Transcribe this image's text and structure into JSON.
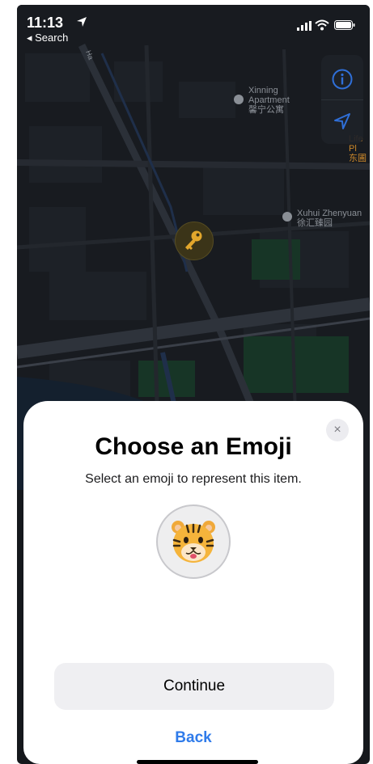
{
  "status_bar": {
    "time": "11:13",
    "back_app": "◂ Search",
    "icons": [
      "location-arrow-icon",
      "cellular-signal-icon",
      "wifi-icon",
      "battery-icon"
    ]
  },
  "map": {
    "pois": [
      {
        "name_en": "Xinning",
        "name_en_2": "Apartment",
        "name_zh": "馨宁公寓"
      },
      {
        "name_en": "Xuhui Zhenyuan",
        "name_zh": "徐汇臻园"
      },
      {
        "name_en": "Life Pl",
        "name_zh": "东圃"
      }
    ],
    "street_label": "Ha",
    "pin_icon": "key-icon",
    "controls": [
      "info-icon",
      "location-arrow-icon"
    ]
  },
  "sheet": {
    "title": "Choose an Emoji",
    "subtitle": "Select an emoji to represent this item.",
    "selected_emoji": "tiger-face",
    "close_label": "×",
    "continue_label": "Continue",
    "back_label": "Back"
  },
  "colors": {
    "accent": "#2f7bea",
    "map_background": "#15181c",
    "sheet_background": "#ffffff",
    "button_background": "#efeff2",
    "key_pin": "#e3a72c"
  }
}
